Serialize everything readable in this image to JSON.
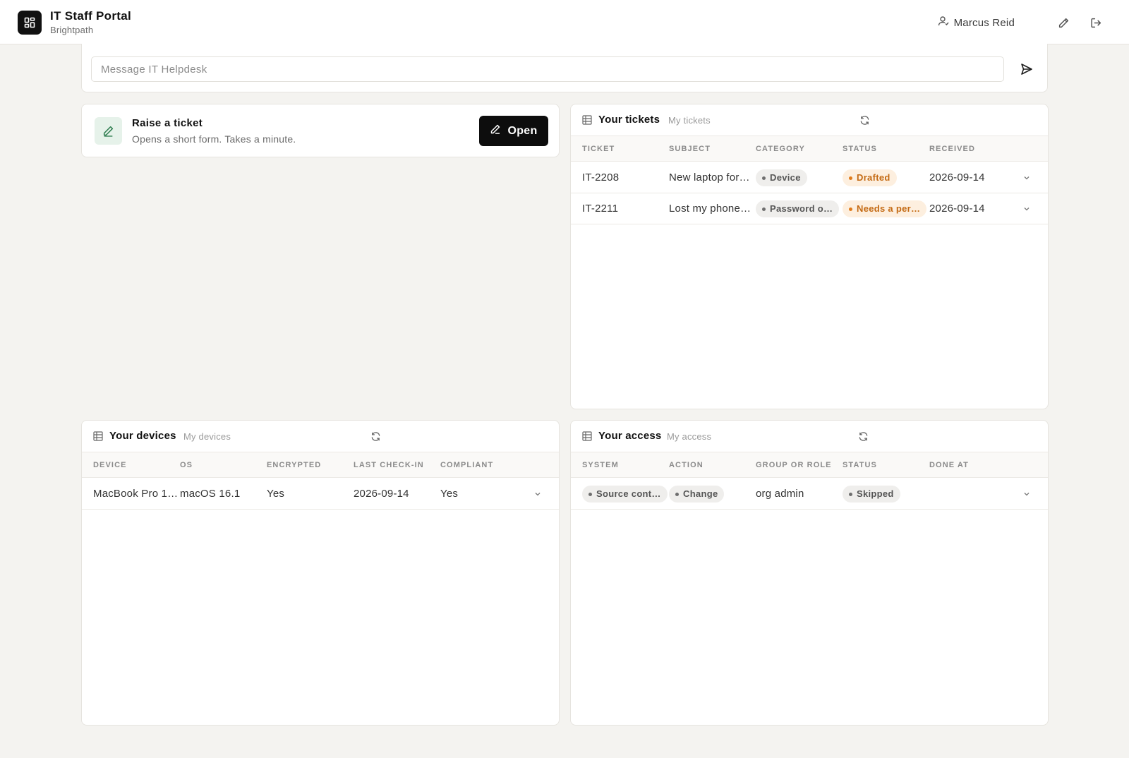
{
  "header": {
    "app_title": "IT Staff Portal",
    "org_name": "Brightpath",
    "user_name": "Marcus Reid",
    "logo_icon": "grid-icon",
    "edit_icon": "pencil-icon",
    "logout_icon": "logout-icon"
  },
  "composer": {
    "placeholder": "Message IT Helpdesk",
    "value": "",
    "send_icon": "send-icon"
  },
  "raise_ticket": {
    "title": "Raise a ticket",
    "description": "Opens a short form. Takes a minute.",
    "button_label": "Open",
    "icon": "pencil-icon"
  },
  "tickets": {
    "title": "Your tickets",
    "subtitle": "My tickets",
    "columns": [
      "TICKET",
      "SUBJECT",
      "CATEGORY",
      "STATUS",
      "RECEIVED"
    ],
    "rows": [
      {
        "ticket": "IT-2208",
        "subject": "New laptop for…",
        "category": "Device",
        "status": "Drafted",
        "received": "2026-09-14"
      },
      {
        "ticket": "IT-2211",
        "subject": "Lost my phone…",
        "category": "Password o…",
        "status": "Needs a per…",
        "received": "2026-09-14"
      }
    ]
  },
  "devices": {
    "title": "Your devices",
    "subtitle": "My devices",
    "columns": [
      "DEVICE",
      "OS",
      "ENCRYPTED",
      "LAST CHECK-IN",
      "COMPLIANT"
    ],
    "rows": [
      {
        "device": "MacBook Pro 1…",
        "os": "macOS 16.1",
        "encrypted": "Yes",
        "last_checkin": "2026-09-14",
        "compliant": "Yes"
      }
    ]
  },
  "access": {
    "title": "Your access",
    "subtitle": "My access",
    "columns": [
      "SYSTEM",
      "ACTION",
      "GROUP OR ROLE",
      "STATUS",
      "DONE AT"
    ],
    "rows": [
      {
        "system": "Source cont…",
        "action": "Change",
        "group_or_role": "org admin",
        "status": "Skipped",
        "done_at": ""
      }
    ]
  },
  "colors": {
    "background": "#f4f3f0",
    "primary_button": "#0d0d0d",
    "accent_green_bg": "#e6f2ea",
    "warning_pill_bg": "#fdefdf",
    "warning_pill_text": "#c46a13"
  }
}
